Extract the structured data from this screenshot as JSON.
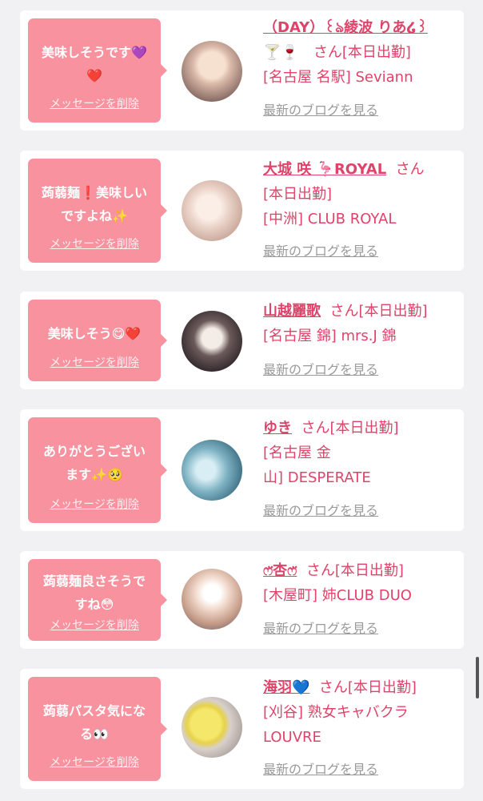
{
  "colors": {
    "accent": "#e0436a",
    "bubble": "#f8929e",
    "muted": "#9a9a9a",
    "background": "#f1f1f3"
  },
  "cards": [
    {
      "bubble_lines": [
        "美味しそうです💜",
        "❤️"
      ],
      "delete_label": "メッセージを削除",
      "name": "（DAY）꒰ঌ綾波 りあ໒꒱",
      "lines": [
        "🍸🍷　さん[本日出勤]",
        "[名古屋 名駅] Seviann"
      ],
      "blog_label": "最新のブログを見る",
      "avatar_icon": "avatar-photo"
    },
    {
      "bubble_lines": [
        "蒟蒻麺❗美味しい",
        "ですよね✨"
      ],
      "delete_label": "メッセージを削除",
      "name": "大城 咲 🦩ROYAL",
      "name_suffix": "さん",
      "lines": [
        "[本日出勤]",
        "[中洲] CLUB ROYAL"
      ],
      "blog_label": "最新のブログを見る",
      "avatar_icon": "avatar-photo"
    },
    {
      "bubble_lines": [
        "美味しそう😋❤️"
      ],
      "delete_label": "メッセージを削除",
      "name": "山越麗歌",
      "name_suffix": "さん[本日出勤]",
      "lines": [
        "[名古屋 錦] mrs.J 錦"
      ],
      "blog_label": "最新のブログを見る",
      "avatar_icon": "avatar-photo"
    },
    {
      "bubble_lines": [
        "ありがとうござい",
        "ます✨🥺"
      ],
      "delete_label": "メッセージを削除",
      "name": "ゆき",
      "name_suffix": "さん[本日出勤]",
      "lines": [
        "[名古屋 金",
        "山] DESPERATE"
      ],
      "blog_label": "最新のブログを見る",
      "avatar_icon": "avatar-photo"
    },
    {
      "bubble_lines": [
        "蒟蒻麺良さそうで",
        "すね😳"
      ],
      "delete_label": "メッセージを削除",
      "name": "ෆ̈杏ෆ̈",
      "name_suffix": "さん[本日出勤]",
      "lines": [
        "[木屋町] 姉CLUB DUO"
      ],
      "blog_label": "最新のブログを見る",
      "avatar_icon": "avatar-photo"
    },
    {
      "bubble_lines": [
        "蒟蒻パスタ気にな",
        "る👀"
      ],
      "delete_label": "メッセージを削除",
      "name": "海羽💙",
      "name_suffix": "さん[本日出勤]",
      "lines": [
        "[刈谷] 熟女キャバクラ",
        "LOUVRE"
      ],
      "blog_label": "最新のブログを見る",
      "avatar_icon": "avatar-photo"
    }
  ]
}
